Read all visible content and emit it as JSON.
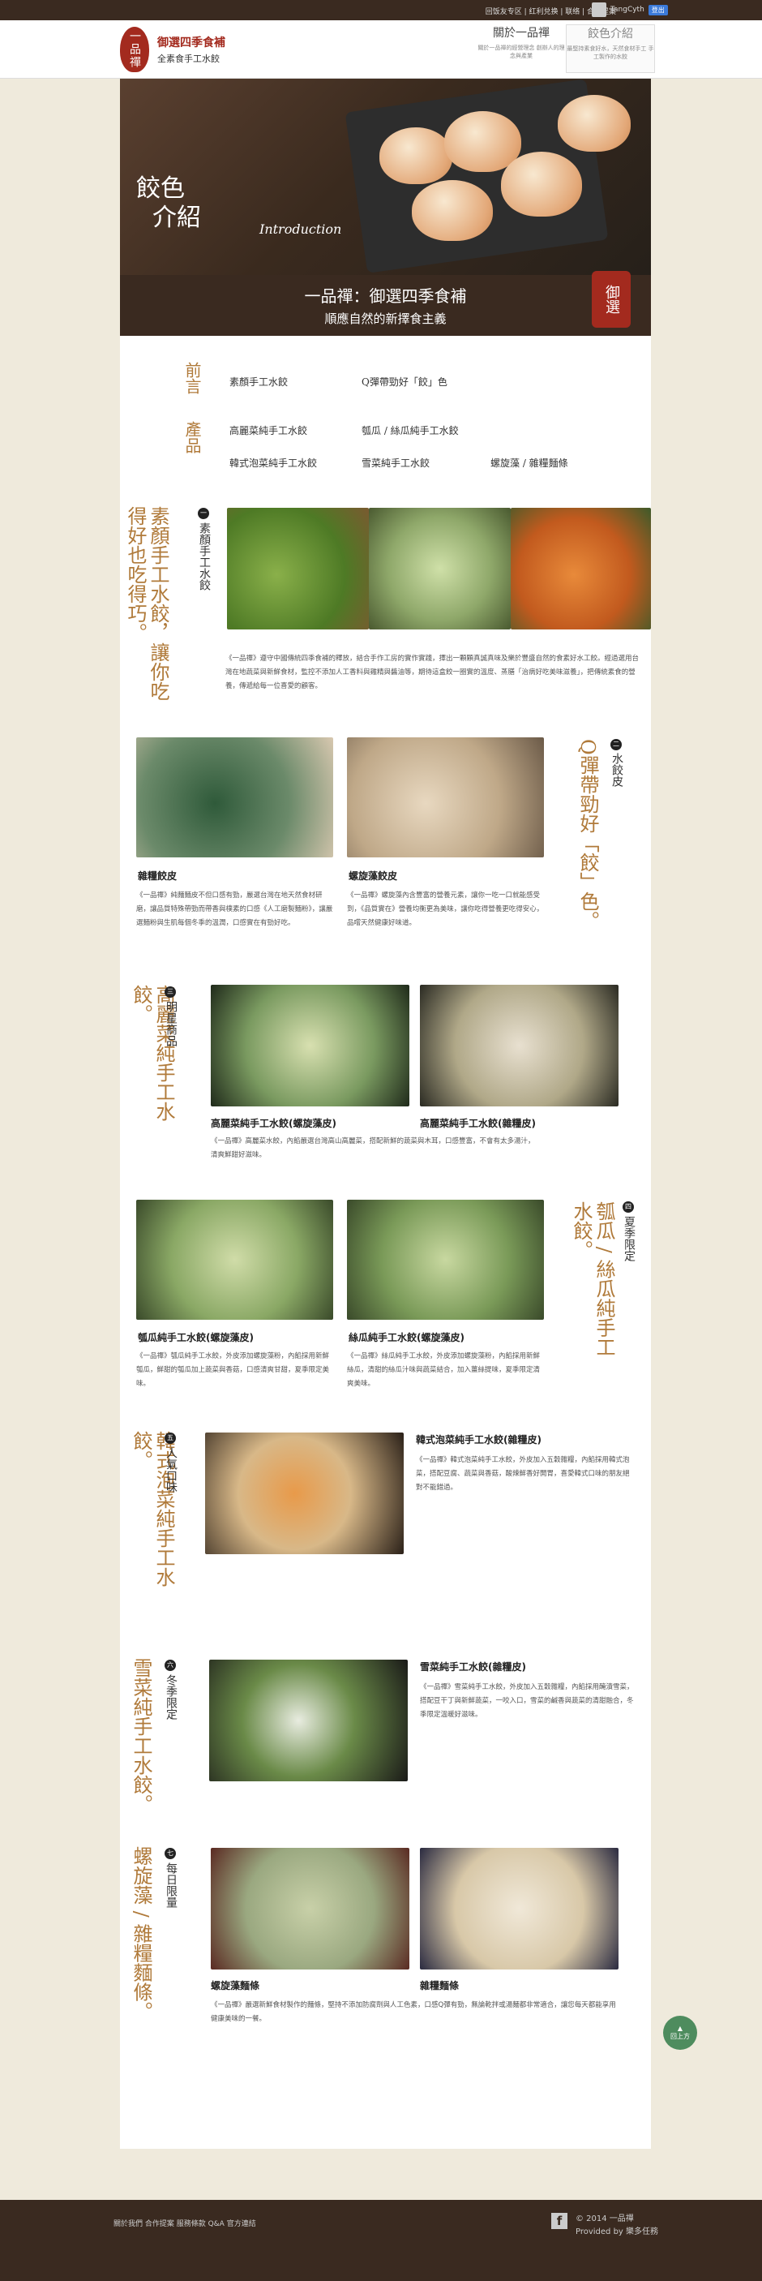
{
  "topbar": {
    "links": "回饭友专区 | 红利兑换 | 联络 | 合作提案",
    "username": "TangCyth",
    "badge": "登出"
  },
  "header": {
    "logo_seal": "一品禪",
    "brand": "御選四季食補",
    "brand_sub": "全素食手工水餃",
    "nav": [
      {
        "label": "關於一品禪",
        "sub": "關於一品禪的經營理念\n創辦人的理念與產業"
      },
      {
        "label": "餃色介紹",
        "sub": "最堅持素食好水，天然食材手工\n手工製作的水餃"
      }
    ]
  },
  "hero": {
    "title1": "餃色",
    "title2": "介紹",
    "intro": "Introduction"
  },
  "band": {
    "line1": "一品禪：御選四季食補",
    "line2": "順應自然的新擇食主義",
    "stamp": "御選"
  },
  "index": {
    "label_a": "前言",
    "label_b": "產品",
    "links": [
      "素顏手工水餃",
      "Q彈帶勁好「餃」色",
      "高麗菜純手工水餃",
      "瓠瓜 / 絲瓜純手工水餃",
      "韓式泡菜純手工水餃",
      "雪菜純手工水餃",
      "螺旋藻 / 雜糧麵條"
    ]
  },
  "sections": [
    {
      "num": "一",
      "sub": "素顏手工水餃",
      "title": "素顏手工水餃，讓你吃得好也吃得巧。",
      "desc": "《一品禪》遵守中國傳統四季食補的釋放，結合手作工房的實作實踐，擇出一顆顆真誠真味及樂於豐盛自然的食素好水工餃。經過選用台灣在地蔬菜與新鮮食材，監控不添加人工香料與雞精與醬油等，期待這盒餃一圈實的溫度、蒸膳「治病好吃美味滋養」，把傳統素食的營養，傳遞給每一位喜愛的顧客。"
    },
    {
      "num": "二",
      "sub": "水餃皮",
      "title": "Q彈帶勁好「餃」色。",
      "items": [
        {
          "cap": "雜糧餃皮",
          "desc": "《一品禪》純麵麵皮不但口感有勁，嚴選台灣在地天然食材研磨，讓品質特殊帶勁而帶香與樸素的口感《人工磨製麵粉》，讓嚴選麵粉與生肌每個冬季的溫潤，口感實在有勁好吃。"
        },
        {
          "cap": "螺旋藻餃皮",
          "desc": "《一品禪》螺旋藻內含豐富的營養元素，讓你一吃一口就能感受到，《品質實在》營養均衡更為美味，讓你吃得營養更吃得安心，品嚐天然健康好味道。"
        }
      ]
    },
    {
      "num": "三",
      "sub": "明星商品",
      "title": "高麗菜純手工水餃。",
      "items": [
        {
          "cap": "高麗菜純手工水餃(螺旋藻皮)",
          "desc": "《一品禪》高麗菜水餃，內餡嚴選台灣高山高麗菜，搭配新鮮的蔬菜與木耳，口感豐富，不會有太多湯汁，清爽鮮甜好滋味。"
        },
        {
          "cap": "高麗菜純手工水餃(雜糧皮)",
          "desc": ""
        }
      ]
    },
    {
      "num": "四",
      "sub": "夏季限定",
      "title": "瓠瓜 / 絲瓜純手工水餃。",
      "items": [
        {
          "cap": "瓠瓜純手工水餃(螺旋藻皮)",
          "desc": "《一品禪》瓠瓜純手工水餃，外皮添加螺旋藻粉，內餡採用新鮮瓠瓜，鮮甜的瓠瓜加上蔬菜與香菇，口感清爽甘甜，夏季限定美味。"
        },
        {
          "cap": "絲瓜純手工水餃(螺旋藻皮)",
          "desc": "《一品禪》絲瓜純手工水餃，外皮添加螺旋藻粉，內餡採用新鮮絲瓜，清甜的絲瓜汁味與蔬菜結合，加入薑絲提味，夏季限定清爽美味。"
        }
      ]
    },
    {
      "num": "五",
      "sub": "人氣口味",
      "title": "韓式泡菜純手工水餃。",
      "items": [
        {
          "cap": "韓式泡菜純手工水餃(雜糧皮)",
          "desc": "《一品禪》韓式泡菜純手工水餃，外皮加入五穀雜糧，內餡採用韓式泡菜，搭配豆腐、蔬菜與香菇，酸辣鮮香好開胃，喜愛韓式口味的朋友絕對不能錯過。"
        }
      ]
    },
    {
      "num": "六",
      "sub": "冬季限定",
      "title": "雪菜純手工水餃。",
      "items": [
        {
          "cap": "雪菜純手工水餃(雜糧皮)",
          "desc": "《一品禪》雪菜純手工水餃，外皮加入五穀雜糧，內餡採用醃漬雪菜，搭配豆干丁與新鮮蔬菜，一咬入口，雪菜的鹹香與蔬菜的清甜融合，冬季限定溫暖好滋味。"
        }
      ]
    },
    {
      "num": "七",
      "sub": "每日限量",
      "title": "螺旋藻 / 雜糧麵條。",
      "items": [
        {
          "cap": "螺旋藻麵條",
          "desc": "《一品禪》嚴選新鮮食材製作的麵條，堅持不添加防腐劑與人工色素，口感Q彈有勁，無論乾拌或湯麵都非常適合，讓您每天都能享用健康美味的一餐。"
        },
        {
          "cap": "雜糧麵條",
          "desc": ""
        }
      ]
    }
  ],
  "gotop": "回上方",
  "footer": {
    "links": "關於我們   合作提案   服務條款   Q&A   官方連結",
    "copy": "© 2014 一品禪",
    "provided": "Provided by 樂多任務",
    "fb": "f"
  }
}
